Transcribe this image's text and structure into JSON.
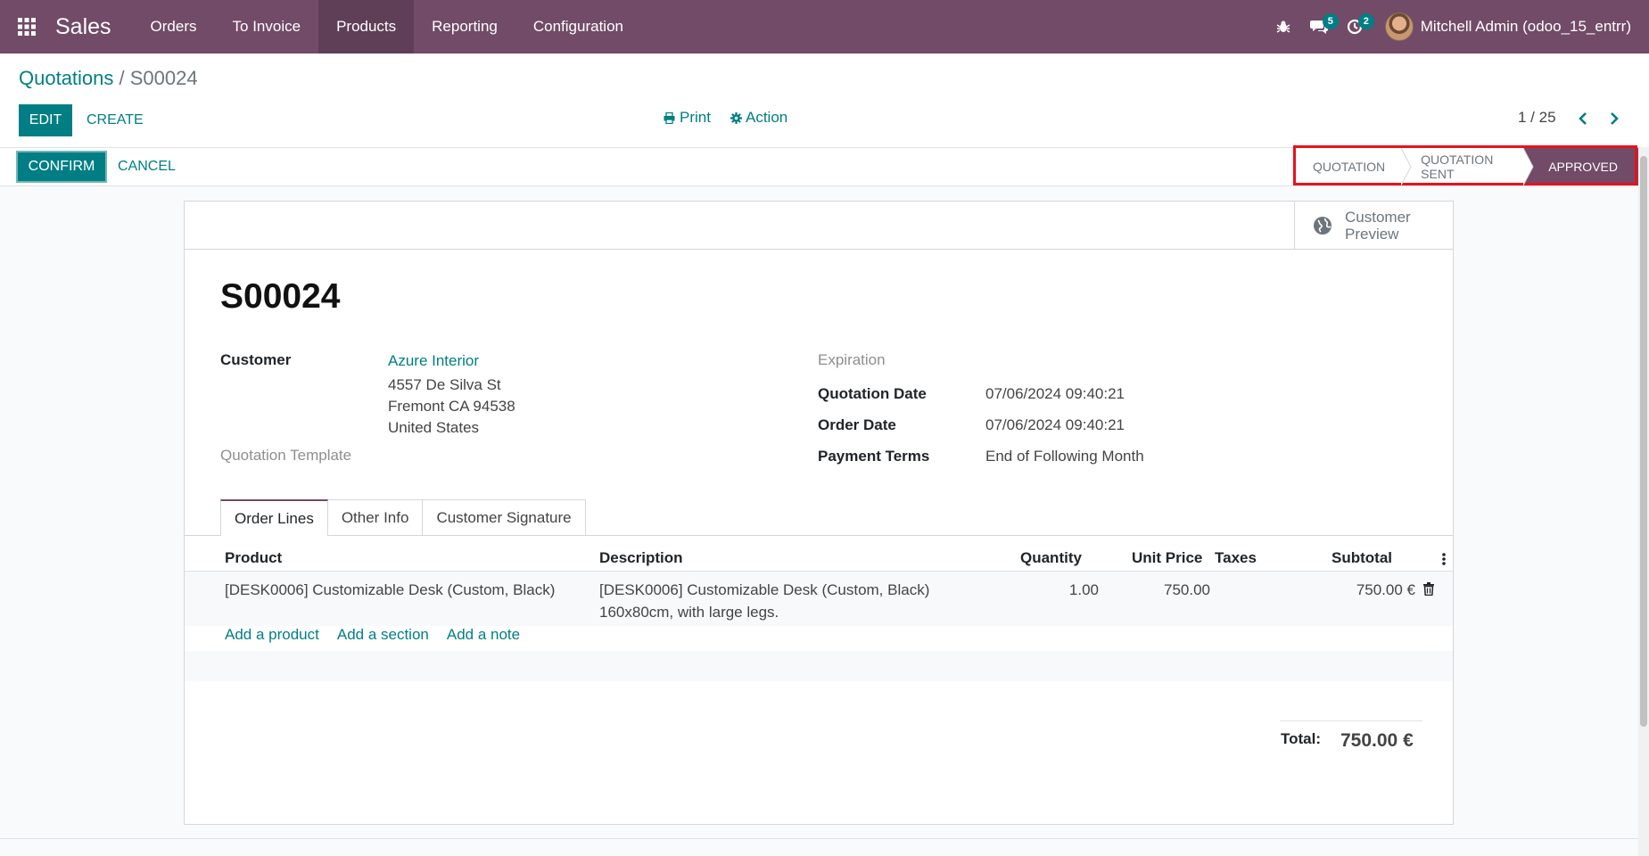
{
  "navbar": {
    "app_name": "Sales",
    "menu": [
      {
        "label": "Orders"
      },
      {
        "label": "To Invoice"
      },
      {
        "label": "Products"
      },
      {
        "label": "Reporting"
      },
      {
        "label": "Configuration"
      }
    ],
    "messages_badge": "5",
    "activities_badge": "2",
    "user_name": "Mitchell Admin (odoo_15_entrr)"
  },
  "control_panel": {
    "breadcrumb_parent": "Quotations",
    "breadcrumb_separator": " / ",
    "breadcrumb_current": "S00024",
    "edit_label": "EDIT",
    "create_label": "CREATE",
    "print_label": "Print",
    "action_label": "Action",
    "pager": "1 / 25"
  },
  "statusbar": {
    "confirm_label": "CONFIRM",
    "cancel_label": "CANCEL",
    "stages": [
      "QUOTATION",
      "QUOTATION SENT",
      "APPROVED"
    ],
    "current_stage": "APPROVED"
  },
  "sheet": {
    "preview_label_1": "Customer",
    "preview_label_2": "Preview",
    "title": "S00024",
    "customer_label": "Customer",
    "customer_name": "Azure Interior",
    "address_line_1": "4557 De Silva St",
    "address_line_2": "Fremont CA 94538",
    "address_line_3": "United States",
    "template_label": "Quotation Template",
    "expiration_label": "Expiration",
    "quotation_date_label": "Quotation Date",
    "quotation_date": "07/06/2024 09:40:21",
    "order_date_label": "Order Date",
    "order_date": "07/06/2024 09:40:21",
    "payment_terms_label": "Payment Terms",
    "payment_terms": "End of Following Month",
    "tabs": [
      {
        "label": "Order Lines"
      },
      {
        "label": "Other Info"
      },
      {
        "label": "Customer Signature"
      }
    ],
    "columns": {
      "product": "Product",
      "description": "Description",
      "quantity": "Quantity",
      "unit_price": "Unit Price",
      "taxes": "Taxes",
      "subtotal": "Subtotal"
    },
    "line": {
      "product": "[DESK0006] Customizable Desk (Custom, Black)",
      "description_1": "[DESK0006] Customizable Desk (Custom, Black)",
      "description_2": "160x80cm, with large legs.",
      "quantity": "1.00",
      "unit_price": "750.00",
      "taxes": "",
      "subtotal": "750.00 €"
    },
    "add_product": "Add a product",
    "add_section": "Add a section",
    "add_note": "Add a note",
    "total_label": "Total:",
    "total_value": "750.00 €"
  },
  "colors": {
    "brand": "#714B67",
    "accent": "#017e84",
    "highlight": "#e8111b"
  }
}
